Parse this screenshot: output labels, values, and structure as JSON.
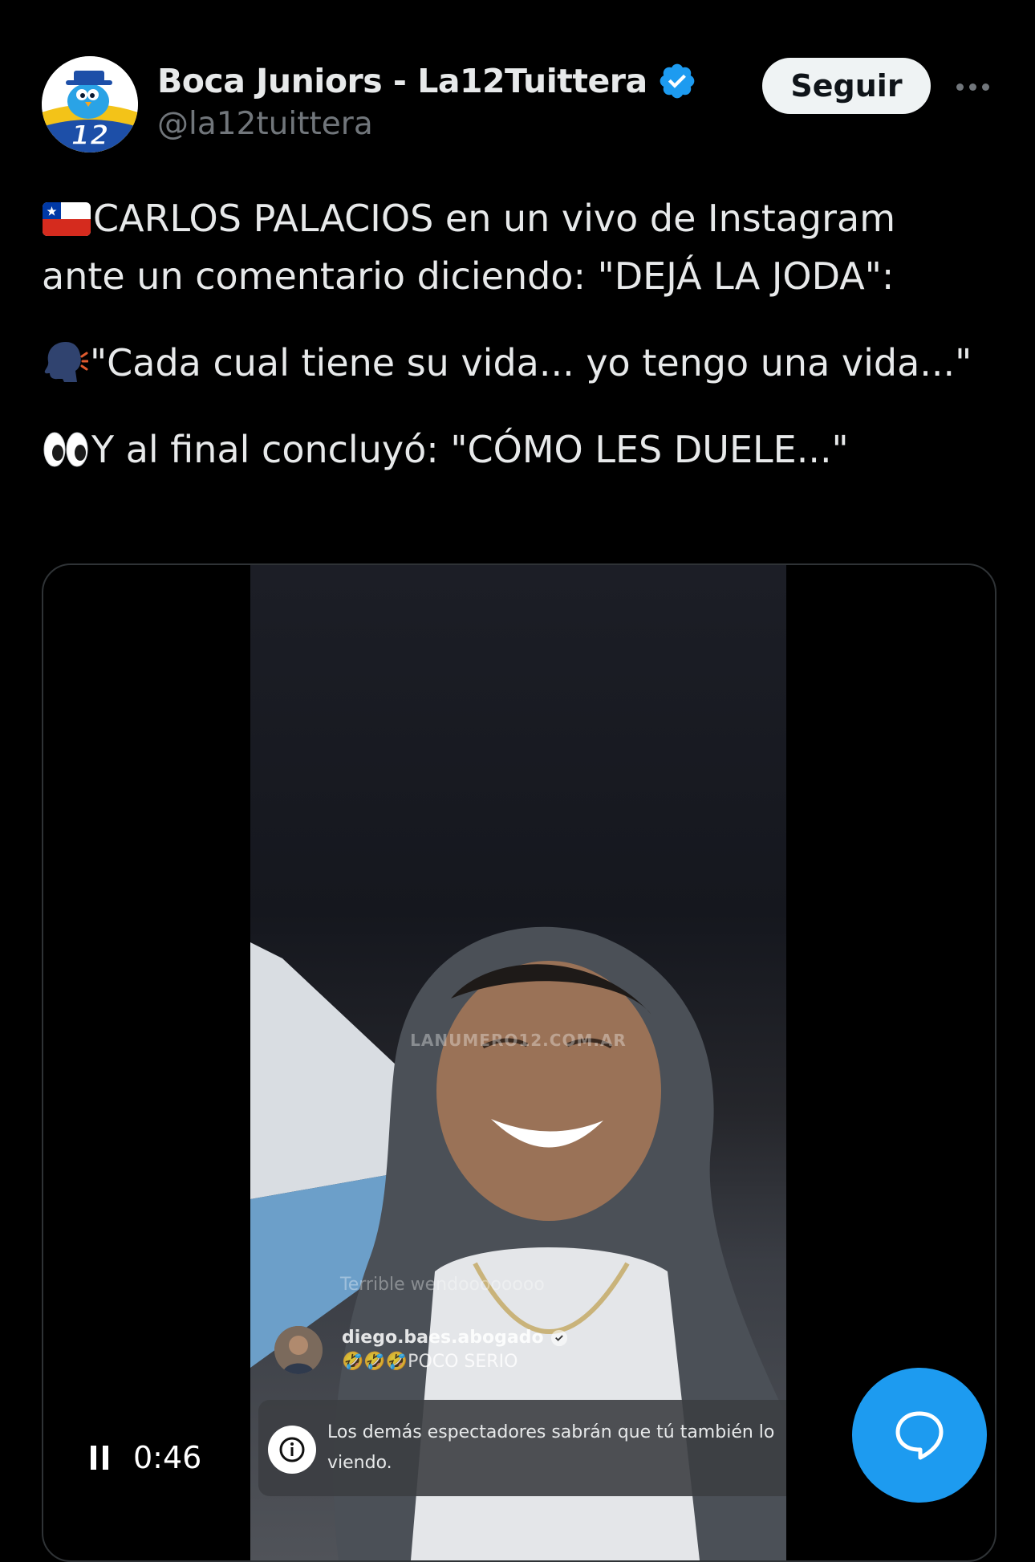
{
  "author": {
    "display_name": "Boca Juniors - La12Tuittera",
    "handle": "@la12tuittera",
    "avatar_text": "12",
    "verified": true
  },
  "actions": {
    "follow_label": "Seguir",
    "more_icon": "more-horizontal-icon"
  },
  "tweet": {
    "line1": "CARLOS PALACIOS en un vivo de Instagram",
    "line2": "ante un comentario diciendo: \"DEJÁ LA JODA\":",
    "line3": "\"Cada cual tiene su vida... yo tengo una vida...\"",
    "line4": "Y al final concluyó: \"CÓMO LES DUELE...\"",
    "emoji1": "chile-flag-icon",
    "emoji2": "speaking-head-icon",
    "emoji3": "eyes-icon"
  },
  "video": {
    "watermark": "LANUMERO12.COM.AR",
    "faded_comment": "Terrible wendoooooooo",
    "comment_user": "diego.baes.abogado",
    "comment_text": "🤣🤣🤣POCO SERIO",
    "notice_text": "Los demás espectadores sabrán que tú también lo viendo.",
    "time": "0:46",
    "playing": true
  },
  "colors": {
    "background": "#000000",
    "text": "#e7e9ea",
    "secondary": "#71767b",
    "accent": "#1d9bf0",
    "follow_bg": "#eff3f4"
  },
  "fab_icon": "chat-bubble-icon"
}
